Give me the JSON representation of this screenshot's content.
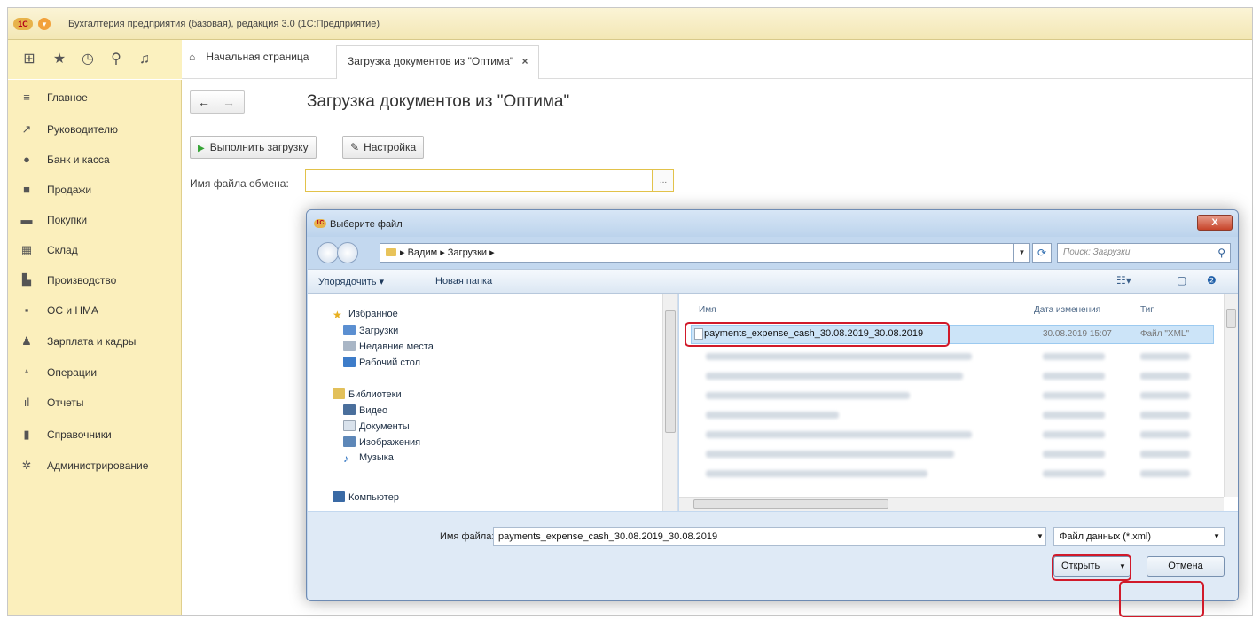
{
  "app": {
    "logo_text": "1С",
    "title": "Бухгалтерия предприятия (базовая), редакция 3.0 (1С:Предприятие)"
  },
  "toolbar": {
    "icons": [
      "apps-grid-icon",
      "star-icon",
      "history-icon",
      "search-icon",
      "bell-icon"
    ],
    "home_label": "Начальная страница",
    "active_tab_label": "Загрузка документов из \"Оптима\"",
    "close_glyph": "×"
  },
  "sidebar": {
    "items": [
      {
        "label": "Главное",
        "icon": "menu-lines-icon"
      },
      {
        "label": "Руководителю",
        "icon": "trend-chart-icon"
      },
      {
        "label": "Банк и касса",
        "icon": "bank-icon"
      },
      {
        "label": "Продажи",
        "icon": "sales-icon"
      },
      {
        "label": "Покупки",
        "icon": "cart-icon"
      },
      {
        "label": "Склад",
        "icon": "warehouse-icon"
      },
      {
        "label": "Производство",
        "icon": "factory-icon"
      },
      {
        "label": "ОС и НМА",
        "icon": "truck-icon"
      },
      {
        "label": "Зарплата и кадры",
        "icon": "person-icon"
      },
      {
        "label": "Операции",
        "icon": "operations-icon"
      },
      {
        "label": "Отчеты",
        "icon": "bar-chart-icon"
      },
      {
        "label": "Справочники",
        "icon": "book-icon"
      },
      {
        "label": "Администрирование",
        "icon": "gear-icon"
      }
    ]
  },
  "form": {
    "title": "Загрузка документов из \"Оптима\"",
    "run_button": "Выполнить загрузку",
    "settings_button": "Настройка",
    "file_label": "Имя файла обмена:",
    "file_value": "",
    "file_button": "..."
  },
  "dialog": {
    "title": "Выберите файл",
    "close_glyph": "X",
    "path": "▸ Вадим ▸ Загрузки ▸",
    "search_placeholder": "Поиск: Загрузки",
    "organize_label": "Упорядочить ▾",
    "new_folder_label": "Новая папка",
    "tree": {
      "favorites": {
        "label": "Избранное",
        "items": [
          "Загрузки",
          "Недавние места",
          "Рабочий стол"
        ]
      },
      "libraries": {
        "label": "Библиотеки",
        "items": [
          "Видео",
          "Документы",
          "Изображения",
          "Музыка"
        ]
      },
      "computer": "Компьютер"
    },
    "columns": {
      "name": "Имя",
      "date": "Дата изменения",
      "type": "Тип"
    },
    "selected_file": {
      "name": "payments_expense_cash_30.08.2019_30.08.2019",
      "date": "30.08.2019 15:07",
      "type": "Файл \"XML\""
    },
    "file_name_label": "Имя файла:",
    "file_name_value": "payments_expense_cash_30.08.2019_30.08.2019",
    "filter_label": "Файл данных (*.xml)",
    "open_button": "Открыть",
    "cancel_button": "Отмена"
  },
  "colors": {
    "sidebar_bg": "#fbefbc",
    "dialog_frame": "#c3d8ef",
    "highlight": "#d11a2a",
    "selection": "#cce4f8"
  }
}
